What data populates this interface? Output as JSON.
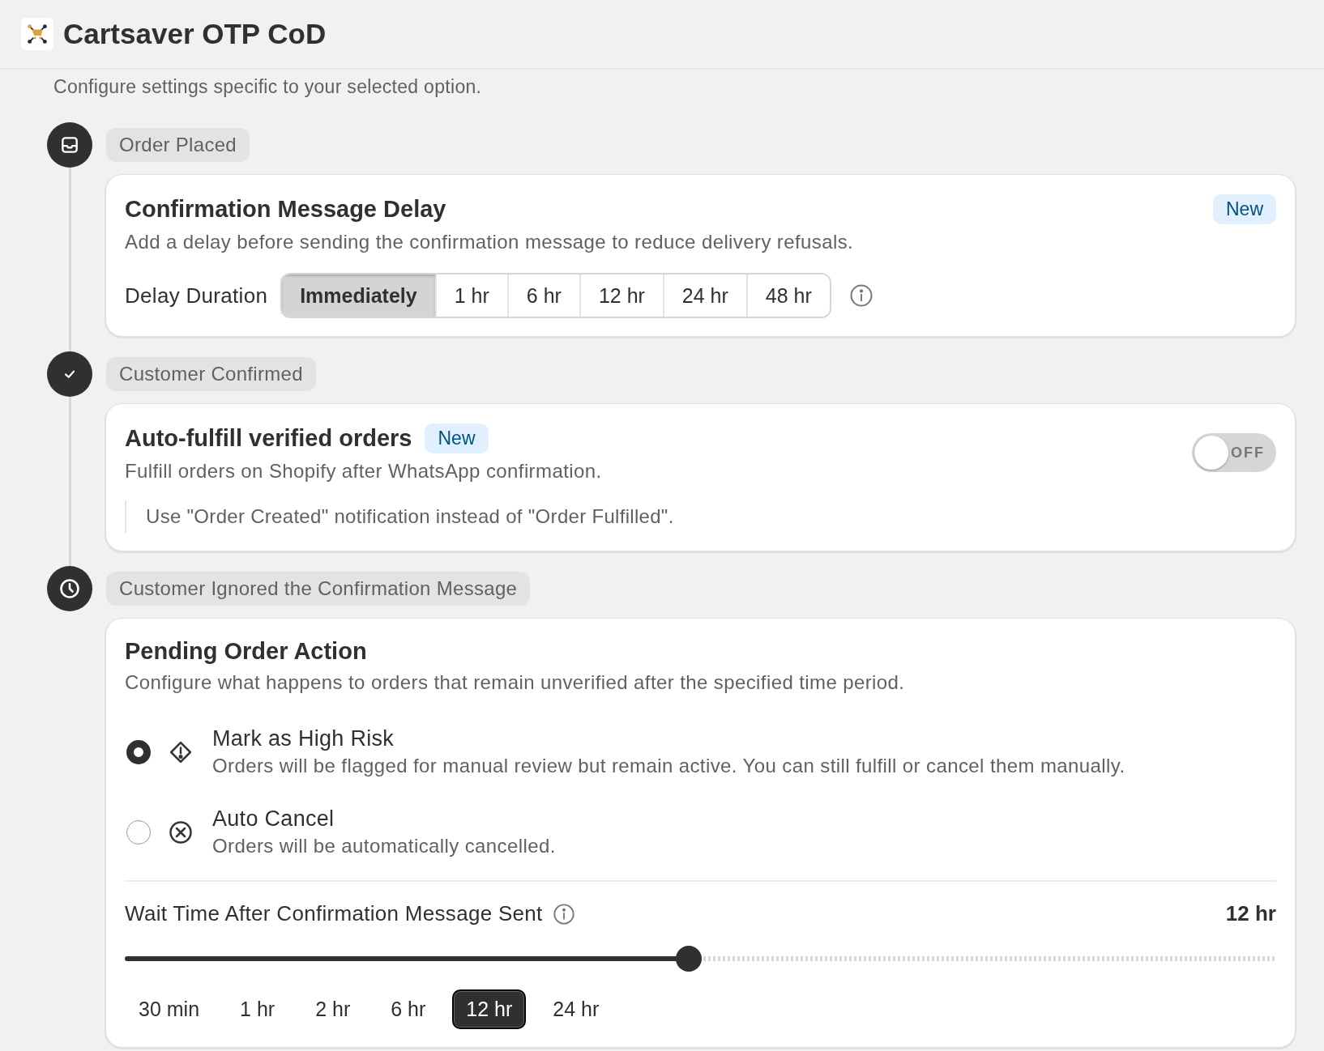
{
  "app": {
    "title": "Cartsaver OTP CoD"
  },
  "intro": "Configure settings specific to your selected option.",
  "steps": [
    {
      "kind": "inbox",
      "label": "Order Placed",
      "card": {
        "kind": "delay",
        "title": "Confirmation Message Delay",
        "badge": "New",
        "description": "Add a delay before sending the confirmation message to reduce delivery refusals.",
        "field_label": "Delay Duration",
        "options": [
          {
            "label": "Immediately",
            "selected": true
          },
          {
            "label": "1 hr",
            "selected": false
          },
          {
            "label": "6 hr",
            "selected": false
          },
          {
            "label": "12 hr",
            "selected": false
          },
          {
            "label": "24 hr",
            "selected": false
          },
          {
            "label": "48 hr",
            "selected": false
          }
        ]
      }
    },
    {
      "kind": "check",
      "label": "Customer Confirmed",
      "card": {
        "kind": "toggle",
        "title": "Auto-fulfill verified orders",
        "badge": "New",
        "description": "Fulfill orders on Shopify after WhatsApp confirmation.",
        "toggle": {
          "on": false,
          "label": "OFF"
        },
        "note": "Use \"Order Created\" notification instead of \"Order Fulfilled\"."
      }
    },
    {
      "kind": "clock",
      "label": "Customer Ignored the Confirmation Message",
      "card": {
        "kind": "action",
        "title": "Pending Order Action",
        "description": "Configure what happens to orders that remain unverified after the specified time period.",
        "choices": [
          {
            "kind": "warning",
            "title": "Mark as High Risk",
            "description": "Orders will be flagged for manual review but remain active. You can still fulfill or cancel them manually.",
            "selected": true
          },
          {
            "kind": "cancel",
            "title": "Auto Cancel",
            "description": "Orders will be automatically cancelled.",
            "selected": false
          }
        ],
        "wait": {
          "label": "Wait Time After Confirmation Message Sent",
          "value": "12 hr",
          "level": 0.49,
          "presets": [
            {
              "label": "30 min",
              "selected": false
            },
            {
              "label": "1 hr",
              "selected": false
            },
            {
              "label": "2 hr",
              "selected": false
            },
            {
              "label": "6 hr",
              "selected": false
            },
            {
              "label": "12 hr",
              "selected": true
            },
            {
              "label": "24 hr",
              "selected": false
            }
          ]
        }
      }
    }
  ]
}
